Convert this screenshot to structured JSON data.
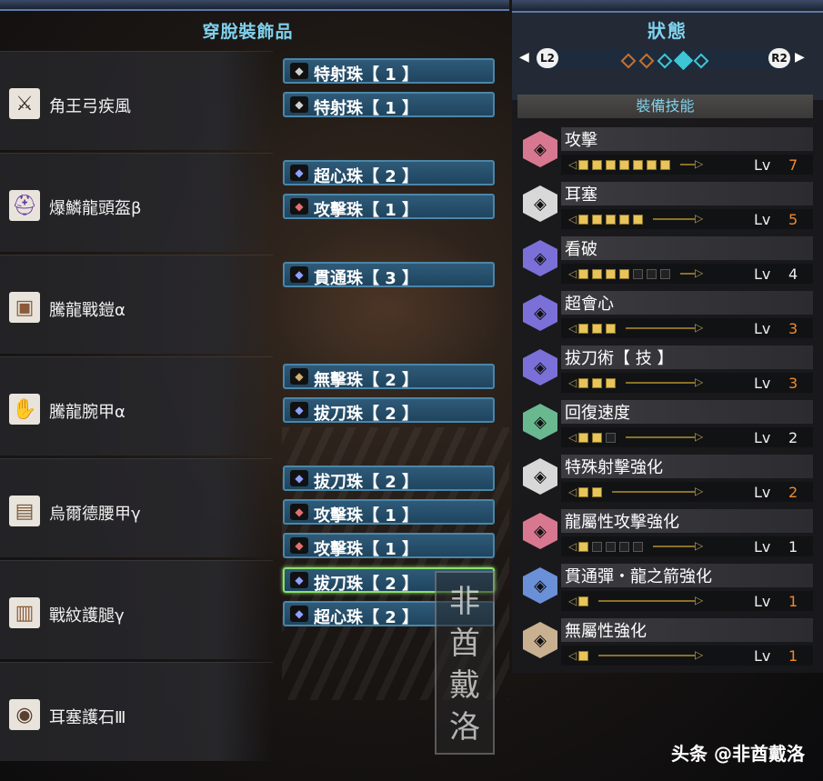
{
  "left": {
    "title": "穿脫裝飾品",
    "equipment": [
      {
        "name": "角王弓疾風",
        "icon": "bow-icon",
        "icon_color": "#3a2a20",
        "decorations": [
          {
            "name": "特射珠【 1 】",
            "color": "#d0d0d0"
          },
          {
            "name": "特射珠【 1 】",
            "color": "#d0d0d0"
          }
        ]
      },
      {
        "name": "爆鱗龍頭盔β",
        "icon": "helm-icon",
        "icon_color": "#6a3a9a",
        "decorations": [
          {
            "name": "超心珠【 2 】",
            "color": "#8fa0ff"
          },
          {
            "name": "攻擊珠【 1 】",
            "color": "#e07070"
          }
        ]
      },
      {
        "name": "騰龍戰鎧α",
        "icon": "chest-armor-icon",
        "icon_color": "#8a5a3a",
        "decorations": [
          {
            "name": "貫通珠【 3 】",
            "color": "#8fa0ff"
          }
        ]
      },
      {
        "name": "騰龍腕甲α",
        "icon": "gauntlet-icon",
        "icon_color": "#8a5a3a",
        "decorations": [
          {
            "name": "無擊珠【 2 】",
            "color": "#d0b070"
          },
          {
            "name": "拔刀珠【 2 】",
            "color": "#8fa0ff"
          }
        ]
      },
      {
        "name": "烏爾德腰甲γ",
        "icon": "waist-armor-icon",
        "icon_color": "#7a5a3a",
        "decorations": [
          {
            "name": "拔刀珠【 2 】",
            "color": "#8fa0ff"
          },
          {
            "name": "攻擊珠【 1 】",
            "color": "#e07070"
          },
          {
            "name": "攻擊珠【 1 】",
            "color": "#e07070"
          }
        ]
      },
      {
        "name": "戰紋護腿γ",
        "icon": "leg-armor-icon",
        "icon_color": "#8a5a3a",
        "decorations": [
          {
            "name": "拔刀珠【 2 】",
            "color": "#8fa0ff",
            "selected": true
          },
          {
            "name": "超心珠【 2 】",
            "color": "#8fa0ff"
          }
        ]
      },
      {
        "name": "耳塞護石Ⅲ",
        "icon": "charm-icon",
        "icon_color": "#5a4030",
        "decorations": []
      }
    ]
  },
  "right": {
    "title": "狀態",
    "prev_button": "L2",
    "next_button": "R2",
    "pages": [
      {
        "color": "#c8702a",
        "active": false
      },
      {
        "color": "#c8702a",
        "active": false
      },
      {
        "color": "#3ec6d4",
        "active": false
      },
      {
        "color": "#3ec6d4",
        "active": true
      },
      {
        "color": "#3ec6d4",
        "active": false
      }
    ],
    "skills_header": "裝備技能",
    "lv_label": "Lv",
    "skills": [
      {
        "name": "攻擊",
        "level": "7",
        "max": 7,
        "icon_color": "#d87890",
        "level_color": "#f08a2c"
      },
      {
        "name": "耳塞",
        "level": "5",
        "max": 5,
        "icon_color": "#d8d8d8",
        "level_color": "#f08a2c"
      },
      {
        "name": "看破",
        "level": "4",
        "max": 7,
        "icon_color": "#7a70d8",
        "level_color": "#eeeeee"
      },
      {
        "name": "超會心",
        "level": "3",
        "max": 3,
        "icon_color": "#7a70d8",
        "level_color": "#f08a2c"
      },
      {
        "name": "拔刀術【 技 】",
        "level": "3",
        "max": 3,
        "icon_color": "#7a70d8",
        "level_color": "#f08a2c"
      },
      {
        "name": "回復速度",
        "level": "2",
        "max": 3,
        "icon_color": "#6ab890",
        "level_color": "#eeeeee"
      },
      {
        "name": "特殊射擊強化",
        "level": "2",
        "max": 2,
        "icon_color": "#d8d8d8",
        "level_color": "#f08a2c"
      },
      {
        "name": "龍屬性攻擊強化",
        "level": "1",
        "max": 5,
        "icon_color": "#d87890",
        "level_color": "#eeeeee"
      },
      {
        "name": "貫通彈・龍之箭強化",
        "level": "1",
        "max": 1,
        "icon_color": "#6a90d8",
        "level_color": "#f08a2c"
      },
      {
        "name": "無屬性強化",
        "level": "1",
        "max": 1,
        "icon_color": "#c8b090",
        "level_color": "#f08a2c"
      }
    ]
  },
  "watermark": {
    "chars": [
      "非",
      "酋",
      "戴",
      "洛"
    ]
  },
  "credit": "头条 @非酋戴洛"
}
